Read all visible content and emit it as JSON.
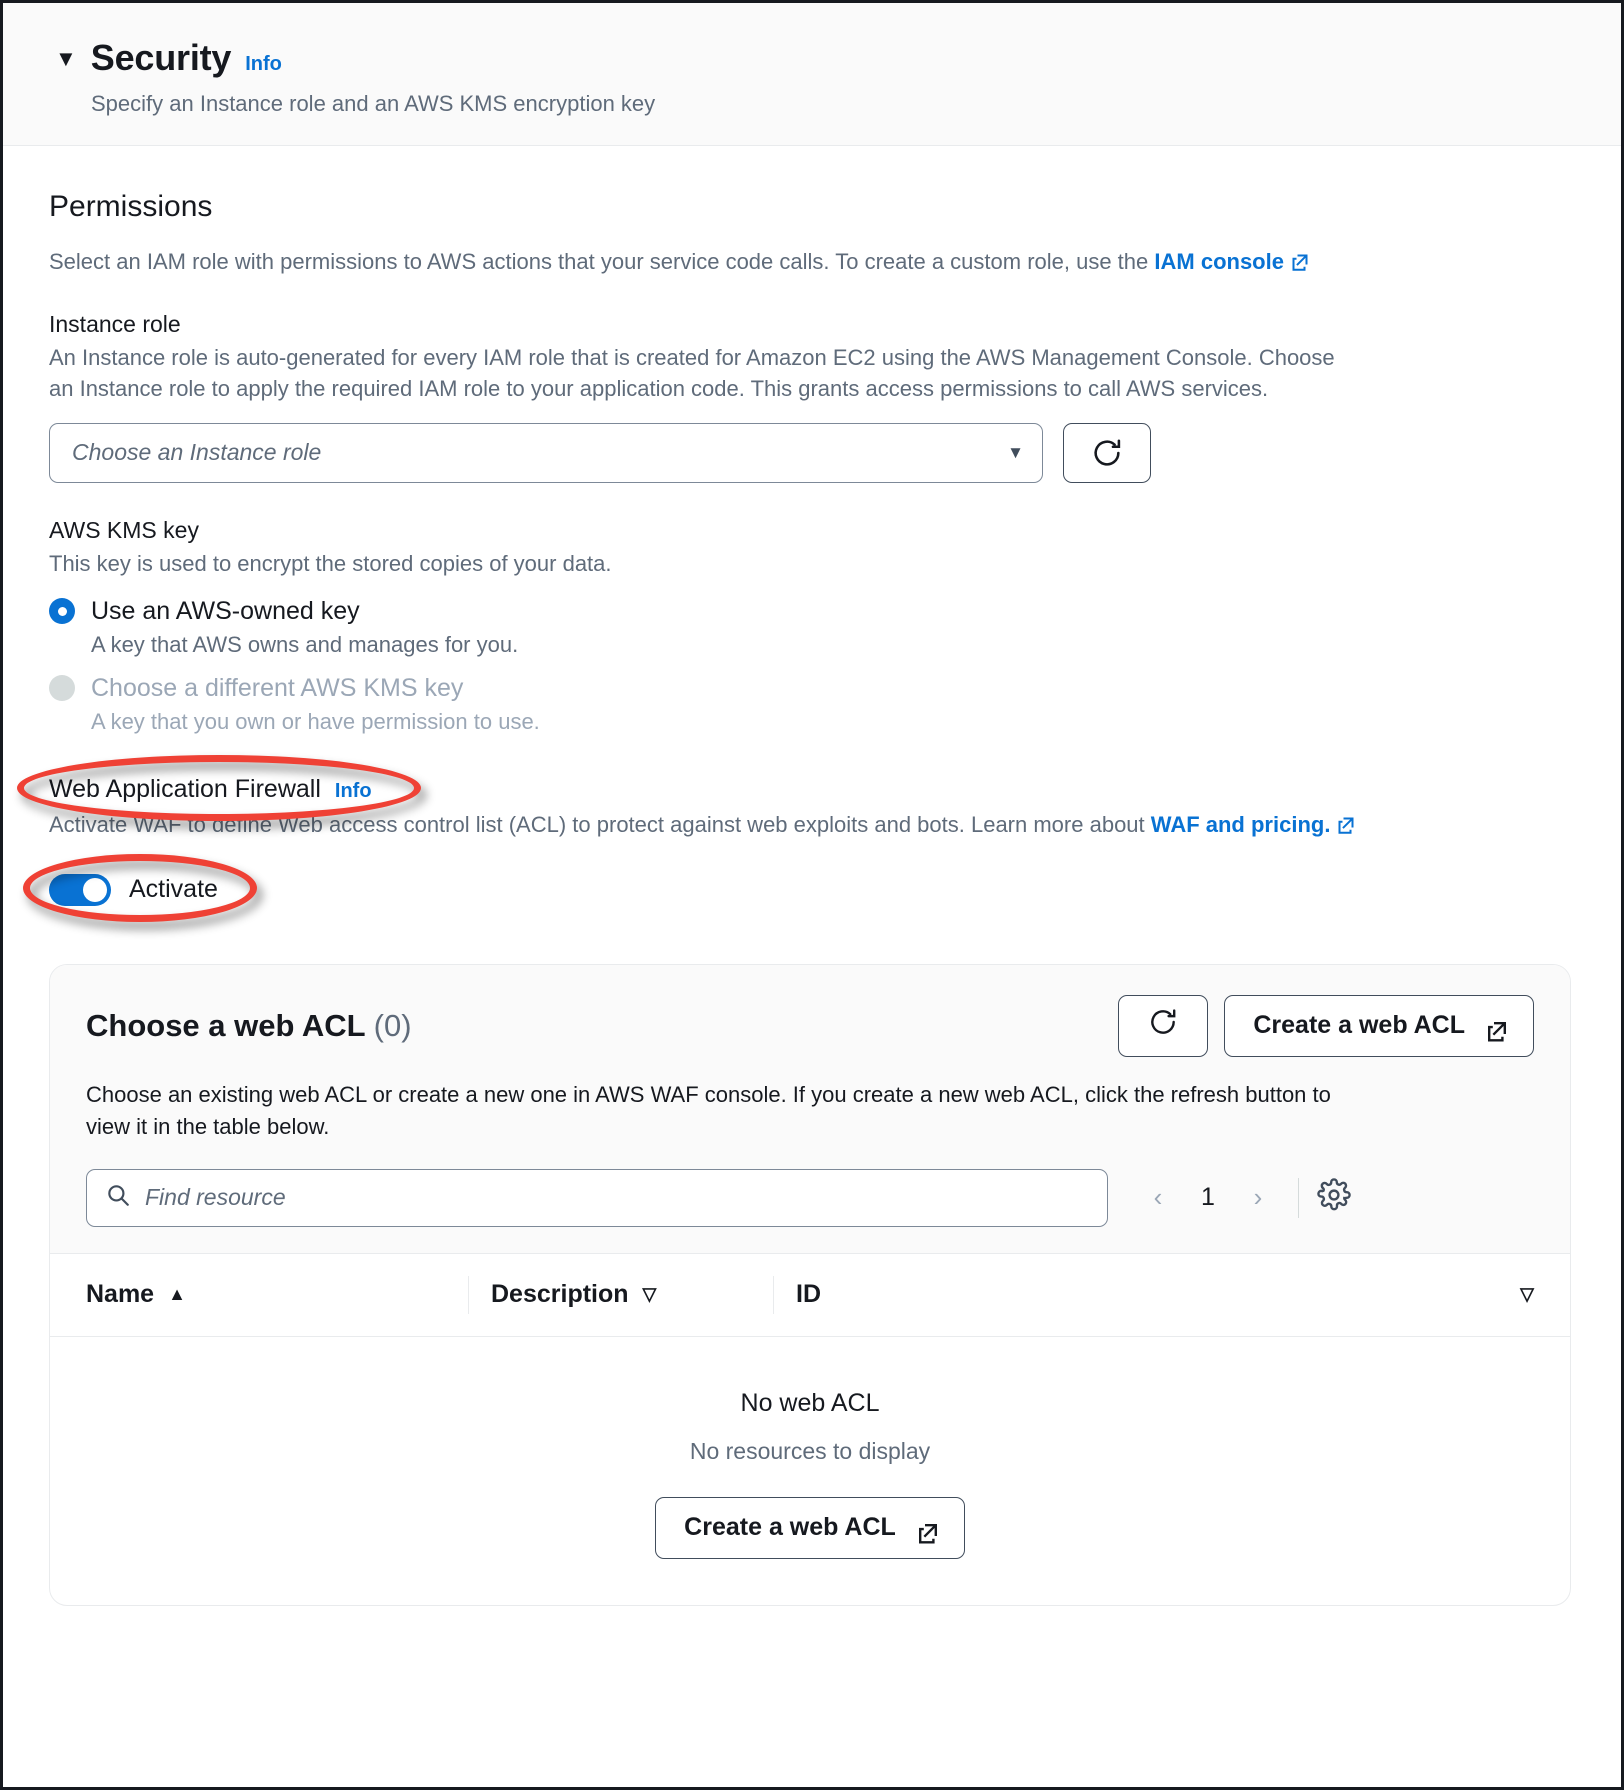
{
  "section": {
    "title": "Security",
    "info_label": "Info",
    "subtitle": "Specify an Instance role and an AWS KMS encryption key",
    "caret_glyph": "▼"
  },
  "permissions": {
    "heading": "Permissions",
    "description_before_link": "Select an IAM role with permissions to AWS actions that your service code calls. To create a custom role, use the ",
    "link_label": "IAM console"
  },
  "instance_role": {
    "label": "Instance role",
    "description": "An Instance role is auto-generated for every IAM role that is created for Amazon EC2 using the AWS Management Console. Choose an Instance role to apply the required IAM role to your application code. This grants access permissions to call AWS services.",
    "placeholder": "Choose an Instance role",
    "dropdown_arrow": "▼",
    "refresh_icon": "refresh-icon"
  },
  "kms": {
    "label": "AWS KMS key",
    "description": "This key is used to encrypt the stored copies of your data.",
    "options": [
      {
        "label": "Use an AWS-owned key",
        "description": "A key that AWS owns and manages for you.",
        "selected": true,
        "disabled": false
      },
      {
        "label": "Choose a different AWS KMS key",
        "description": "A key that you own or have permission to use.",
        "selected": false,
        "disabled": true
      }
    ]
  },
  "waf": {
    "title": "Web Application Firewall",
    "info_label": "Info",
    "description_before_link": "Activate WAF to define Web access control list (ACL) to protect against web exploits and bots. Learn more about ",
    "link_label": "WAF and pricing.",
    "toggle_label": "Activate",
    "toggle_on": true
  },
  "acl": {
    "title": "Choose a web ACL",
    "count": "(0)",
    "refresh_icon": "refresh-icon",
    "create_button": "Create a web ACL",
    "description": "Choose an existing web ACL or create a new one in AWS WAF console. If you create a new web ACL, click the refresh button to view it in the table below.",
    "search_placeholder": "Find resource",
    "search_value": "",
    "search_icon": "search-icon",
    "pagination": {
      "prev": "‹",
      "page": "1",
      "next": "›"
    },
    "settings_icon": "gear-icon",
    "columns": [
      {
        "label": "Name",
        "sort": "▲"
      },
      {
        "label": "Description",
        "sort": "▽"
      },
      {
        "label": "ID",
        "sort": "▽"
      }
    ],
    "empty_title": "No web ACL",
    "empty_subtitle": "No resources to display",
    "empty_button": "Create a web ACL"
  },
  "colors": {
    "accent": "#0972d3",
    "annotation": "#ef4135",
    "text": "#16191f",
    "muted": "#5f6b7a",
    "disabled": "#9ba7b6"
  }
}
